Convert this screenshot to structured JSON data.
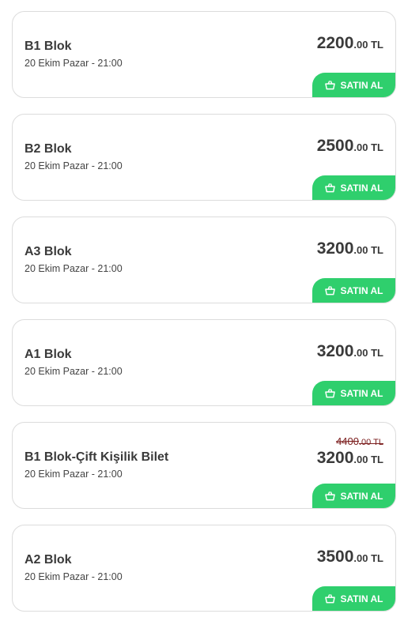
{
  "colors": {
    "accent": "#2fcf6d",
    "old_price": "#7a1c1c",
    "text": "#3a3a3a",
    "border": "#dcdcdc"
  },
  "currency": "TL",
  "buy_icon": "basket-icon",
  "tickets": [
    {
      "name": "B1 Blok",
      "date": "20 Ekim Pazar - 21:00",
      "price": "2200",
      "cents": ".00 TL",
      "buy_label": "SATIN AL"
    },
    {
      "name": "B2 Blok",
      "date": "20 Ekim Pazar - 21:00",
      "price": "2500",
      "cents": ".00 TL",
      "buy_label": "SATIN AL"
    },
    {
      "name": "A3 Blok",
      "date": "20 Ekim Pazar - 21:00",
      "price": "3200",
      "cents": ".00 TL",
      "buy_label": "SATIN AL"
    },
    {
      "name": "A1 Blok",
      "date": "20 Ekim Pazar - 21:00",
      "price": "3200",
      "cents": ".00 TL",
      "buy_label": "SATIN AL"
    },
    {
      "name": "B1 Blok-Çift Kişilik Bilet",
      "date": "20 Ekim Pazar - 21:00",
      "old_price": "4400",
      "old_cents": ".00 TL",
      "price": "3200",
      "cents": ".00 TL",
      "buy_label": "SATIN AL"
    },
    {
      "name": "A2 Blok",
      "date": "20 Ekim Pazar - 21:00",
      "price": "3500",
      "cents": ".00 TL",
      "buy_label": "SATIN AL"
    }
  ]
}
